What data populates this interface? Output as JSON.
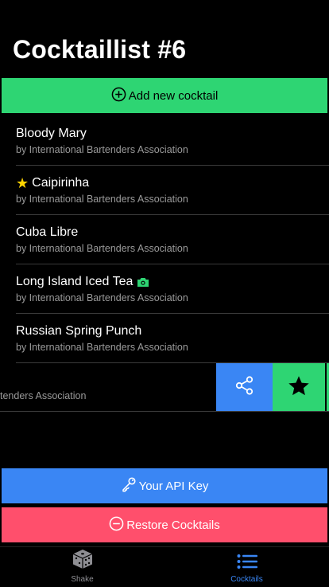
{
  "page": {
    "title": "Cocktaillist #6"
  },
  "actions": {
    "add_label": "Add new cocktail",
    "api_label": "Your API Key",
    "restore_label": "Restore Cocktails"
  },
  "cocktails": [
    {
      "name": "Bloody Mary",
      "author": "by International Bartenders Association",
      "favorite": false,
      "has_photo": false
    },
    {
      "name": "Caipirinha",
      "author": "by International Bartenders Association",
      "favorite": true,
      "has_photo": false
    },
    {
      "name": "Cuba Libre",
      "author": "by International Bartenders Association",
      "favorite": false,
      "has_photo": false
    },
    {
      "name": "Long Island Iced Tea",
      "author": "by International Bartenders Association",
      "favorite": false,
      "has_photo": true
    },
    {
      "name": "Russian Spring Punch",
      "author": "by International Bartenders Association",
      "favorite": false,
      "has_photo": false
    }
  ],
  "swiped_row": {
    "author_fragment": "tenders Association",
    "share_icon": "share-icon",
    "favorite_icon": "star-icon"
  },
  "tabs": [
    {
      "label": "Shake",
      "icon": "dice-icon",
      "active": false
    },
    {
      "label": "Cocktails",
      "icon": "list-icon",
      "active": true
    }
  ],
  "colors": {
    "green": "#2ed573",
    "blue": "#3a86f4",
    "red": "#ff4f6c",
    "star": "#ffd400"
  }
}
